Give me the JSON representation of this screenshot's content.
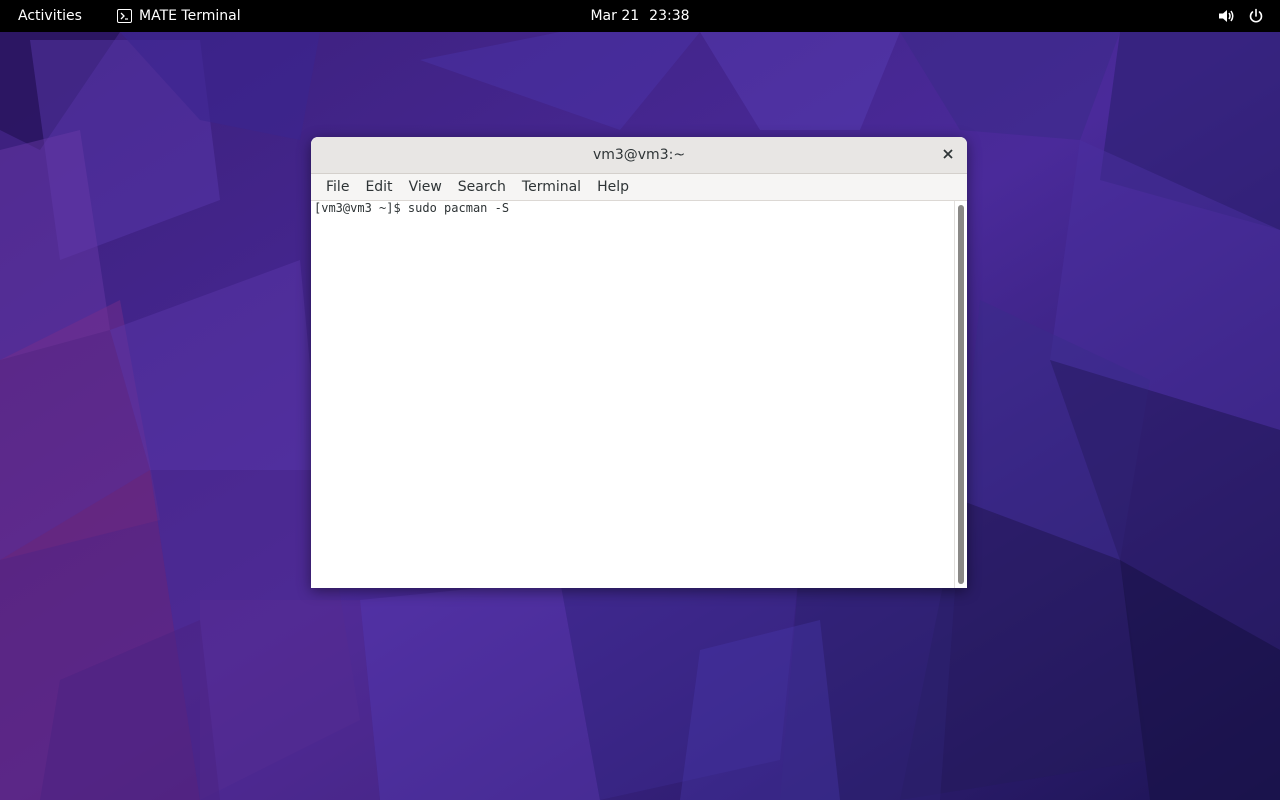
{
  "topbar": {
    "activities_label": "Activities",
    "app_name": "MATE Terminal",
    "app_icon": "terminal-icon",
    "date": "Mar 21",
    "time": "23:38",
    "tray_icons": [
      "volume-icon",
      "power-icon"
    ]
  },
  "window": {
    "title": "vm3@vm3:~",
    "close_icon": "close-icon",
    "menu": {
      "file": "File",
      "edit": "Edit",
      "view": "View",
      "search": "Search",
      "terminal": "Terminal",
      "help": "Help"
    },
    "terminal": {
      "prompt": "[vm3@vm3 ~]$ ",
      "command": "sudo pacman -S"
    }
  },
  "colors": {
    "topbar_bg": "#000000",
    "titlebar_bg": "#e8e6e4",
    "menubar_bg": "#f6f5f4",
    "terminal_bg": "#ffffff",
    "wallpaper_base": "#3a1a70"
  }
}
